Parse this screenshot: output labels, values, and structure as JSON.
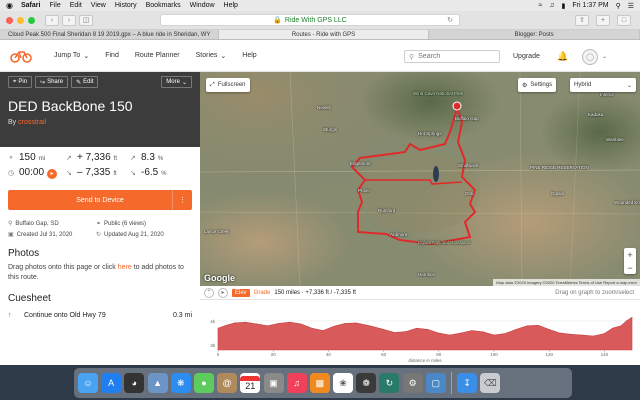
{
  "menubar": {
    "apple": "",
    "app": "Safari",
    "items": [
      "File",
      "Edit",
      "View",
      "History",
      "Bookmarks",
      "Window",
      "Help"
    ],
    "clock": "Fri 1:37 PM"
  },
  "browser": {
    "url": "Ride With GPS LLC",
    "tabs": [
      "Cloud Peak 500 Final Sheridan 8 19 2019.gpx – A blue ride in Sheridan, WY",
      "Routes - Ride with GPS",
      "Blogger: Posts"
    ]
  },
  "header": {
    "nav": [
      "Jump To",
      "Find",
      "Route Planner",
      "Stories",
      "Help"
    ],
    "search_placeholder": "Search",
    "upgrade": "Upgrade"
  },
  "route": {
    "buttons": {
      "pin": "Pin",
      "share": "Share",
      "edit": "Edit",
      "more": "More"
    },
    "title": "DED BackBone 150",
    "by_prefix": "By",
    "author": "crosstrail",
    "stats": {
      "distance": "150",
      "distance_unit": "mi",
      "ascent": "+ 7,336",
      "ascent_unit": "ft",
      "grade_up": "8.3",
      "grade_up_unit": "%",
      "time": "00:00",
      "descent": "– 7,335",
      "descent_unit": "ft",
      "grade_down": "-6.5",
      "grade_down_unit": "%"
    },
    "send_button": "Send to Device",
    "meta": {
      "location": "Buffalo Gap, SD",
      "privacy": "Public (6 views)",
      "created": "Created Jul 31, 2020",
      "updated": "Updated Aug 21, 2020"
    },
    "photos_title": "Photos",
    "photos_before": "Drag photos onto this page or click ",
    "photos_link": "here",
    "photos_after": " to add photos to this route.",
    "cuesheet_title": "Cuesheet",
    "cue_text": "Continue onto Old Hwy 79",
    "cue_dist": "0.3 mi"
  },
  "map": {
    "fullscreen": "Fullscreen",
    "settings": "Settings",
    "map_type": "Hybrid",
    "google": "Google",
    "attribution": "Map data ©2020 Imagery ©2020 TerraMetrics   Terms of Use   Report a map error",
    "places": [
      {
        "t": "Newell",
        "x": 117,
        "y": 33,
        "c": ""
      },
      {
        "t": "Sturgis",
        "x": 123,
        "y": 55,
        "c": ""
      },
      {
        "t": "Wind Cave National Park",
        "x": 213,
        "y": 19,
        "c": "green"
      },
      {
        "t": "Hot Springs",
        "x": 218,
        "y": 59,
        "c": ""
      },
      {
        "t": "Buffalo Gap",
        "x": 255,
        "y": 44,
        "c": ""
      },
      {
        "t": "Edgemont",
        "x": 150,
        "y": 89,
        "c": ""
      },
      {
        "t": "Smithwick",
        "x": 258,
        "y": 91,
        "c": ""
      },
      {
        "t": "Provo",
        "x": 158,
        "y": 116,
        "c": ""
      },
      {
        "t": "Oral",
        "x": 265,
        "y": 119,
        "c": ""
      },
      {
        "t": "Rumford",
        "x": 178,
        "y": 136,
        "c": ""
      },
      {
        "t": "Ardmore",
        "x": 190,
        "y": 160,
        "c": ""
      },
      {
        "t": "Oglala National Grassland",
        "x": 218,
        "y": 168,
        "c": "green"
      },
      {
        "t": "Kadoka",
        "x": 388,
        "y": 40,
        "c": ""
      },
      {
        "t": "PINE RIDGE RESERVATION",
        "x": 330,
        "y": 93,
        "c": ""
      },
      {
        "t": "Oglala",
        "x": 351,
        "y": 119,
        "c": ""
      },
      {
        "t": "Wounded Knee",
        "x": 414,
        "y": 128,
        "c": ""
      },
      {
        "t": "Lance Creek",
        "x": 4,
        "y": 157,
        "c": ""
      },
      {
        "t": "Harrison",
        "x": 218,
        "y": 200,
        "c": ""
      },
      {
        "t": "Wanblee",
        "x": 406,
        "y": 65,
        "c": ""
      },
      {
        "t": "Interior",
        "x": 400,
        "y": 20,
        "c": ""
      }
    ]
  },
  "elevation": {
    "pill": "Elev",
    "grade": "Grade",
    "summary": "150 miles · +7,336 ft / -7,335 ft",
    "hint": "Drag on graph to zoom/select",
    "xlabel": "distance in miles"
  },
  "chart_data": {
    "type": "area",
    "xlabel": "distance in miles",
    "ylabel": "",
    "x_ticks": [
      "0",
      "20",
      "40",
      "60",
      "80",
      "100",
      "120",
      "140"
    ],
    "y_ticks": [
      "4k",
      "3k"
    ],
    "xlim": [
      0,
      150
    ],
    "ylim": [
      2800,
      4700
    ],
    "series": [
      {
        "values": [
          [
            0,
            3700
          ],
          [
            3,
            3820
          ],
          [
            6,
            3920
          ],
          [
            10,
            3950
          ],
          [
            14,
            3880
          ],
          [
            18,
            3800
          ],
          [
            22,
            3900
          ],
          [
            26,
            3950
          ],
          [
            30,
            3880
          ],
          [
            34,
            3700
          ],
          [
            38,
            3600
          ],
          [
            42,
            3780
          ],
          [
            46,
            3900
          ],
          [
            50,
            3920
          ],
          [
            55,
            3800
          ],
          [
            60,
            3650
          ],
          [
            64,
            3520
          ],
          [
            68,
            3560
          ],
          [
            72,
            3700
          ],
          [
            76,
            3650
          ],
          [
            80,
            3500
          ],
          [
            84,
            3420
          ],
          [
            88,
            3500
          ],
          [
            92,
            3600
          ],
          [
            96,
            3550
          ],
          [
            100,
            3420
          ],
          [
            104,
            3480
          ],
          [
            108,
            3650
          ],
          [
            112,
            3800
          ],
          [
            116,
            3820
          ],
          [
            120,
            3650
          ],
          [
            124,
            3500
          ],
          [
            128,
            3450
          ],
          [
            132,
            3420
          ],
          [
            136,
            3380
          ],
          [
            140,
            3480
          ],
          [
            143,
            3700
          ],
          [
            146,
            3800
          ],
          [
            148,
            4000
          ],
          [
            150,
            4150
          ]
        ]
      }
    ]
  },
  "dock": {
    "icons": [
      "finder-icon",
      "app-store-icon",
      "dashboard-icon",
      "preview-icon",
      "safari-icon",
      "messages-icon",
      "contacts-icon",
      "calendar-icon",
      "photos-slides-icon",
      "music-icon",
      "books-icon",
      "photos-icon",
      "iphoto-icon",
      "time-machine-icon",
      "system-preferences-icon",
      "preview-2-icon",
      "downloads-icon",
      "trash-icon"
    ],
    "calendar_day": "21"
  }
}
